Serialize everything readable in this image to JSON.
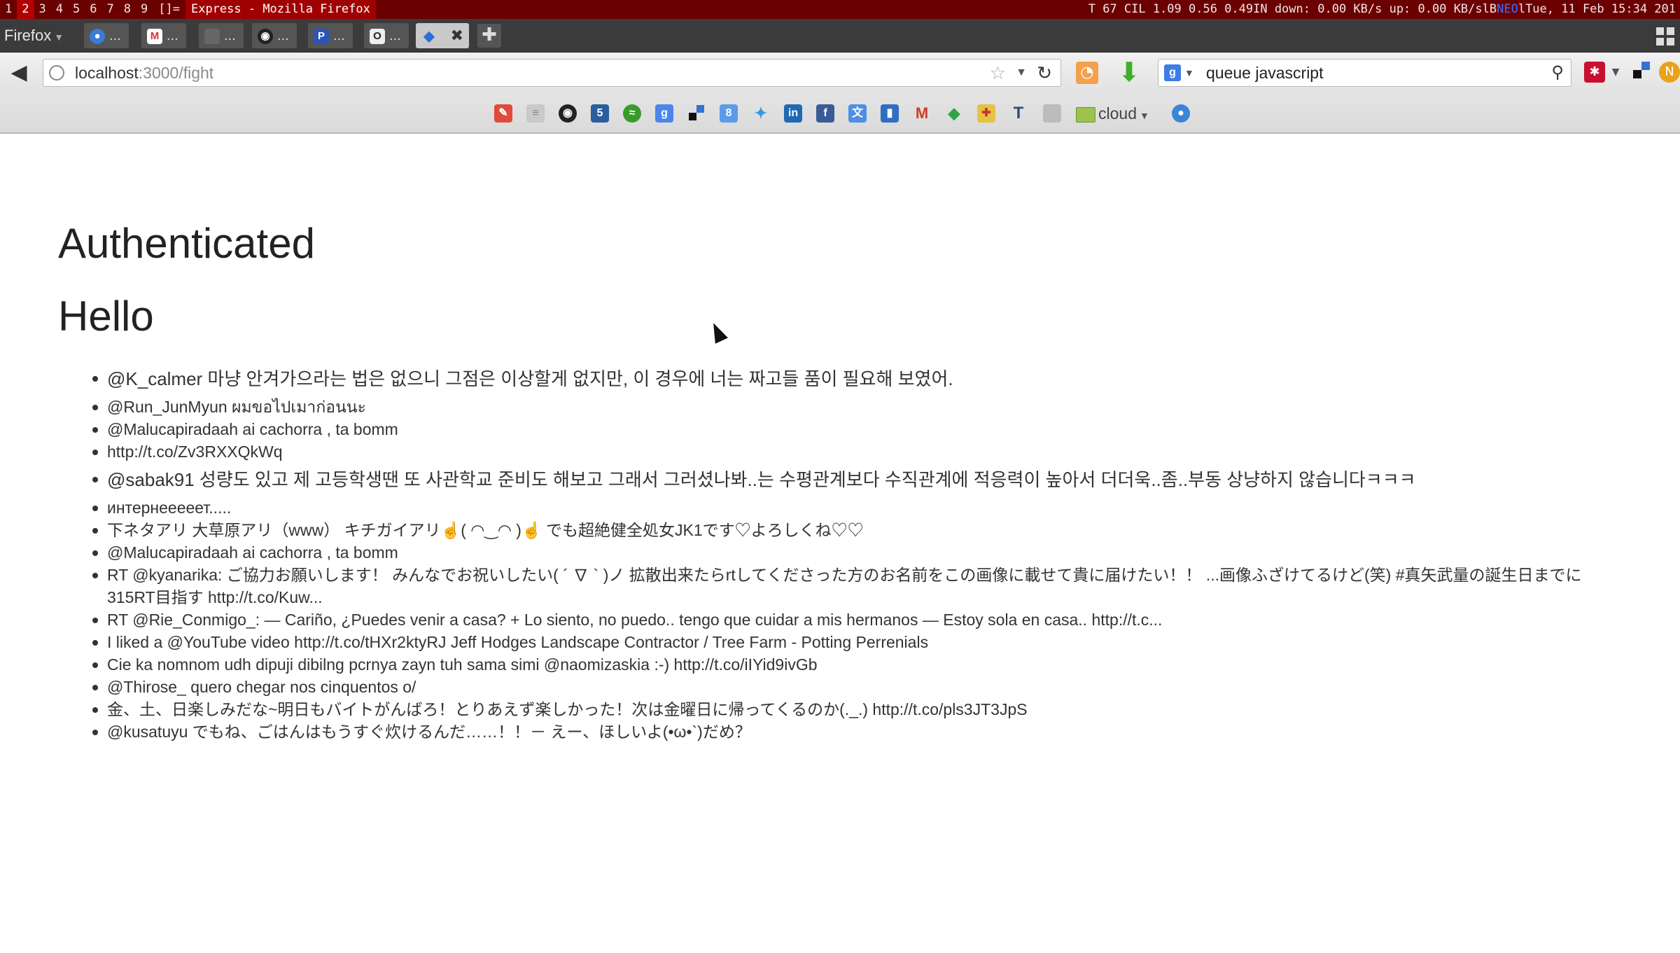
{
  "wm_bar": {
    "workspaces": [
      "1",
      "2",
      "3",
      "4",
      "5",
      "6",
      "7",
      "8",
      "9"
    ],
    "current_workspace": "2",
    "layout": "[]=",
    "window_title": "Express - Mozilla Firefox",
    "stats_prefix": "T 67 CIL 1.09 0.56 0.49IN down: 0.00 KB/s up: 0.00 KB/slB",
    "stats_mid": "NEO",
    "stats_suffix": "lTue, 11 Feb 15:34 201"
  },
  "tab_bar": {
    "menu_label": "Firefox",
    "tabs": [
      {
        "icon": "chat-icon",
        "label": "..."
      },
      {
        "icon": "gmail-icon",
        "label": "..."
      },
      {
        "icon": "blank-page-icon",
        "label": "..."
      },
      {
        "icon": "github-icon",
        "label": "..."
      },
      {
        "icon": "p-icon",
        "label": "..."
      },
      {
        "icon": "o-icon",
        "label": "..."
      },
      {
        "icon": "code-arrows-icon",
        "label": "",
        "active": true
      }
    ]
  },
  "nav": {
    "url_host": "localhost",
    "url_path": ":3000/fight",
    "search_query": "queue javascript"
  },
  "bookmarks": {
    "folder_label": "cloud",
    "icons": [
      "pdf-icon",
      "list-icon",
      "github-icon",
      "html5-icon",
      "spotify-icon",
      "google-plus-icon",
      "delicious-icon",
      "google-plus-icon",
      "twitter-icon",
      "linkedin-icon",
      "facebook-icon",
      "translate-icon",
      "pocket-icon",
      "gmail-icon",
      "feedly-icon",
      "maps-icon",
      "text-icon",
      "bookmark-icon",
      "chat-icon"
    ]
  },
  "page": {
    "heading_authenticated": "Authenticated",
    "heading_hello": "Hello",
    "tweets": [
      {
        "text": "@K_calmer 마냥 안겨가으라는 법은 없으니 그점은 이상할게 없지만, 이 경우에 너는 짜고들 품이 필요해 보였어.",
        "big": true
      },
      {
        "text": "@Run_JunMyun ผมขอไปเมาก่อนนะ",
        "big": false
      },
      {
        "text": "@Malucapiradaah ai cachorra , ta bomm",
        "big": false
      },
      {
        "text": "http://t.co/Zv3RXXQkWq",
        "big": false
      },
      {
        "text": "@sabak91 성량도 있고 제 고등학생땐 또 사관학교 준비도 해보고 그래서 그러셨나봐..는 수평관계보다 수직관계에 적응력이 높아서 더더욱..좀..부동 상냥하지 않습니다ㅋㅋㅋ",
        "big": true
      },
      {
        "text": "интернееееет.....",
        "big": false
      },
      {
        "text": "下ネタアリ 大草原アリ（www） キチガイアリ☝( ◠‿◠ )☝ でも超絶健全処女JK1です♡よろしくね♡♡",
        "big": false
      },
      {
        "text": "@Malucapiradaah ai cachorra , ta bomm",
        "big": false
      },
      {
        "text": "RT @kyanarika: ご協力お願いします！ みんなでお祝いしたい( ´ ∇ ` )ノ 拡散出来たらrtしてくださった方のお名前をこの画像に載せて貴に届けたい！！ ...画像ふざけてるけど(笑) #真矢武量の誕生日までに315RT目指す http://t.co/Kuw...",
        "big": false
      },
      {
        "text": "RT @Rie_Conmigo_: — Cariño, ¿Puedes venir a casa? + Lo siento, no puedo.. tengo que cuidar a mis hermanos — Estoy sola en casa.. http://t.c...",
        "big": false
      },
      {
        "text": "I liked a @YouTube video http://t.co/tHXr2ktyRJ Jeff Hodges Landscape Contractor / Tree Farm - Potting Perrenials",
        "big": false
      },
      {
        "text": "Cie ka nomnom udh dipuji dibilng pcrnya zayn tuh sama simi @naomizaskia :-) http://t.co/iIYid9ivGb",
        "big": false
      },
      {
        "text": "@Thirose_ quero chegar nos cinquentos o/",
        "big": false
      },
      {
        "text": "金、土、日楽しみだな~明日もバイトがんばろ！とりあえず楽しかった！次は金曜日に帰ってくるのか(._.) http://t.co/pls3JT3JpS",
        "big": false
      },
      {
        "text": "@kusatuyu でもね、ごはんはもうすぐ炊けるんだ……！！－ えー、ほしいよ(•ω•`)だめ？",
        "big": false
      }
    ]
  }
}
